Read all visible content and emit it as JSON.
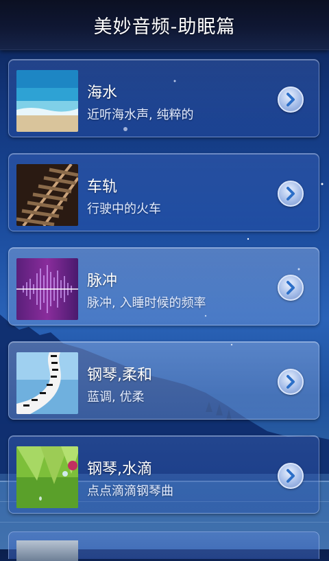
{
  "header": {
    "title": "美妙音频-助眠篇"
  },
  "items": [
    {
      "name": "海水",
      "desc": "近听海水声, 纯粹的",
      "thumb_icon": "ocean-icon"
    },
    {
      "name": "车轨",
      "desc": "行驶中的火车",
      "thumb_icon": "railway-icon"
    },
    {
      "name": "脉冲",
      "desc": "脉冲, 入睡时候的频率",
      "thumb_icon": "pulse-wave-icon"
    },
    {
      "name": "钢琴,柔和",
      "desc": "蓝调, 优柔",
      "thumb_icon": "piano-keys-icon"
    },
    {
      "name": "钢琴,水滴",
      "desc": "点点滴滴钢琴曲",
      "thumb_icon": "water-drop-leaf-icon"
    }
  ],
  "colors": {
    "accent": "#2a63b8",
    "titlebar": "#0f1733"
  }
}
